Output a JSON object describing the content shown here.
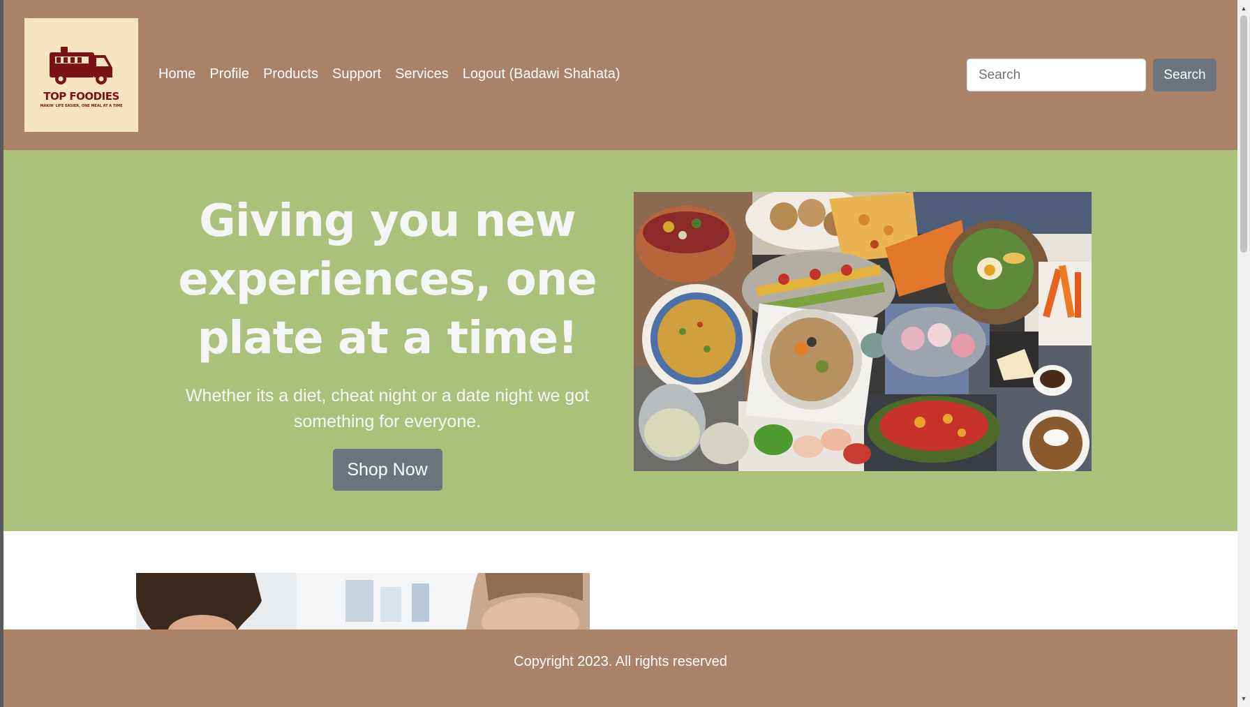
{
  "header": {
    "logo": {
      "title": "TOP FOODIES",
      "tagline": "MAKIN' LIFE EASIER, ONE MEAL AT A TIME",
      "icon": "food-truck-icon",
      "color": "#7a1216",
      "background": "#f6e4c0"
    },
    "nav": [
      {
        "label": "Home"
      },
      {
        "label": "Profile"
      },
      {
        "label": "Products"
      },
      {
        "label": "Support"
      },
      {
        "label": "Services"
      },
      {
        "label": "Logout (Badawi Shahata)"
      }
    ],
    "search": {
      "placeholder": "Search",
      "value": "",
      "button_label": "Search"
    },
    "background": "#a98267"
  },
  "hero": {
    "title": "Giving you new experiences, one plate at a time!",
    "subtitle": "Whether its a diet, cheat night or a date night we got something for everyone.",
    "button_label": "Shop Now",
    "image": "food-collage-image",
    "background": "#abc17b"
  },
  "content": {
    "image": "team-photo-image"
  },
  "footer": {
    "copyright": "Copyright 2023. All rights reserved",
    "background": "#a98267"
  },
  "colors": {
    "button_gray": "#6c757d"
  }
}
